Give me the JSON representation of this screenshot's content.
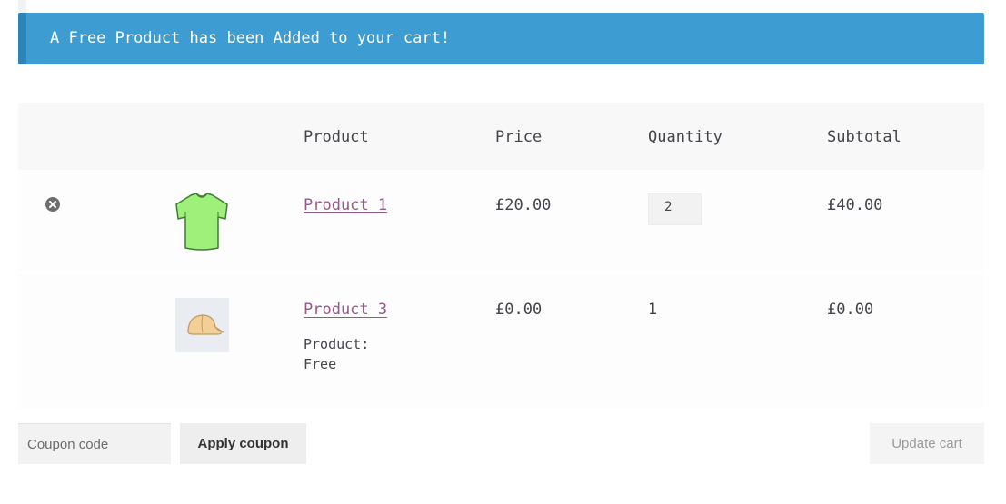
{
  "notice": {
    "message": "A Free Product has been Added to your cart!",
    "color": "#3d9cd2"
  },
  "table": {
    "headers": {
      "product": "Product",
      "price": "Price",
      "quantity": "Quantity",
      "subtotal": "Subtotal"
    },
    "rows": [
      {
        "remove_icon": "close-circle-icon",
        "thumbnail": "green-tshirt",
        "product": "Product 1",
        "price": "£20.00",
        "quantity": "2",
        "subtotal": "£40.00"
      },
      {
        "thumbnail": "cap",
        "product": "Product 3",
        "meta_label": "Product:",
        "meta_value": "Free",
        "price": "£0.00",
        "quantity": "1",
        "subtotal": "£0.00"
      }
    ]
  },
  "actions": {
    "coupon_placeholder": "Coupon code",
    "apply_coupon": "Apply coupon",
    "update_cart": "Update cart"
  },
  "colors": {
    "link": "#96588a",
    "header_bg": "#f8f8f8"
  }
}
